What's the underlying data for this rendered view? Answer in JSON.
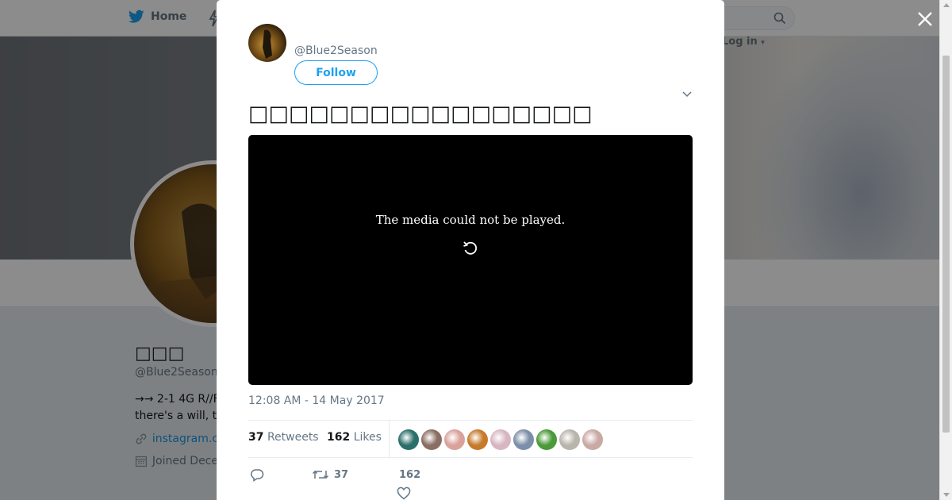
{
  "nav": {
    "home_label": "Home",
    "login_label": "Log in",
    "icons": [
      "twitter-bird-icon",
      "lightning-icon",
      "search-icon",
      "chevron-down-icon"
    ]
  },
  "profile": {
    "name": "□□□",
    "handle": "@Blue2Season",
    "bio_line1": "→→ 2-1 4G R//F",
    "bio_line2": "there's a will, t",
    "link": "instagram.c",
    "joined": "Joined Dece"
  },
  "tweet": {
    "handle": "@Blue2Season",
    "follow_label": "Follow",
    "text": "□□□□□□□□□□□□□□□□□",
    "media_error": "The media could not be played.",
    "timestamp": "12:08 AM - 14 May 2017",
    "retweets_count": "37",
    "retweets_label": "Retweets",
    "likes_count": "162",
    "likes_label": "Likes",
    "action_retweet_count": "37",
    "action_like_count": "162"
  },
  "likers": [
    {
      "name": "liker-1",
      "color": "#2a6f6a"
    },
    {
      "name": "liker-2",
      "color": "#8a6e64"
    },
    {
      "name": "liker-3",
      "color": "#d9a29a"
    },
    {
      "name": "liker-4",
      "color": "#c77a2c"
    },
    {
      "name": "liker-5",
      "color": "#d7b6c2"
    },
    {
      "name": "liker-6",
      "color": "#7d8fa8"
    },
    {
      "name": "liker-7",
      "color": "#4c9a3a"
    },
    {
      "name": "liker-8",
      "color": "#b9b4ac"
    },
    {
      "name": "liker-9",
      "color": "#c9a9a4"
    }
  ],
  "colors": {
    "brand": "#1da1f2",
    "text_primary": "#14171a",
    "text_secondary": "#657786",
    "link": "#1b95e0",
    "overlay": "rgba(0,0,0,0.45)",
    "media_bg": "#000000"
  }
}
